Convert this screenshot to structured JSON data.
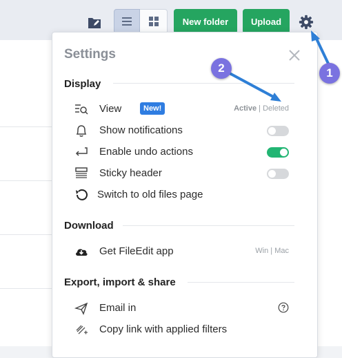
{
  "toolbar": {
    "new_folder_label": "New folder",
    "upload_label": "Upload"
  },
  "settings": {
    "title": "Settings",
    "sections": {
      "display": "Display",
      "download": "Download",
      "export": "Export, import & share"
    },
    "view": {
      "label": "View",
      "badge": "New!",
      "active": "Active",
      "divider": "|",
      "deleted": "Deleted"
    },
    "show_notifications": {
      "label": "Show notifications",
      "enabled": false
    },
    "enable_undo": {
      "label": "Enable undo actions",
      "enabled": true
    },
    "sticky_header": {
      "label": "Sticky header",
      "enabled": false
    },
    "old_files": {
      "label": "Switch to old files page"
    },
    "get_app": {
      "label": "Get FileEdit app",
      "win": "Win",
      "divider": "|",
      "mac": "Mac"
    },
    "email_in": {
      "label": "Email in"
    },
    "copy_link": {
      "label": "Copy link with applied filters"
    }
  },
  "callouts": {
    "marker1": "1",
    "marker2": "2"
  },
  "colors": {
    "primary_green": "#25a560",
    "toggle_on": "#22b573",
    "badge_blue": "#2f7de1",
    "callout_purple": "#7a72e0",
    "callout_arrow": "#2e7fd6"
  }
}
